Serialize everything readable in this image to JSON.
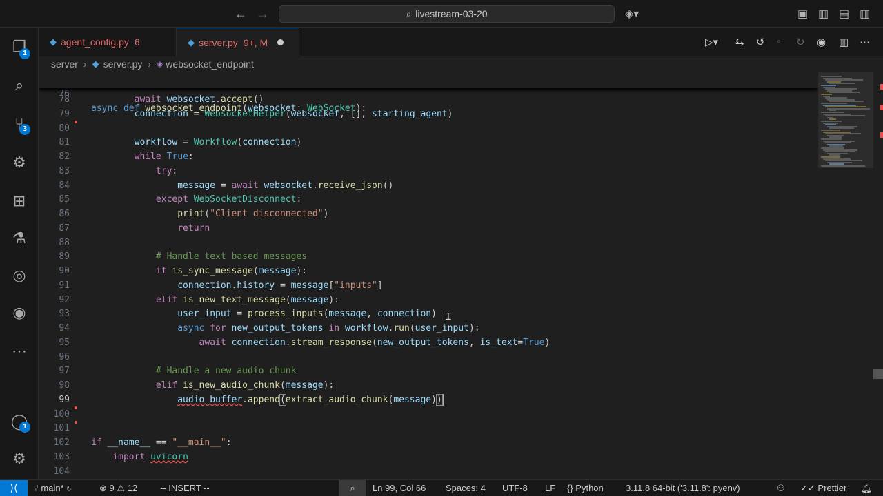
{
  "titlebar": {
    "back_icon": "arrow-left-icon",
    "forward_icon": "arrow-right-icon",
    "search_text": "livestream-03-20",
    "search_icon": "search-icon"
  },
  "activity": {
    "explorer_badge": "1",
    "scm_badge": "3",
    "accounts_badge": "1"
  },
  "tabs": [
    {
      "label": "agent_config.py",
      "badge": "6"
    },
    {
      "label": "server.py",
      "badge": "9+, M"
    }
  ],
  "breadcrumb": {
    "folder": "server",
    "file": "server.py",
    "symbol": "websocket_endpoint"
  },
  "editor": {
    "sticky": {
      "num": "76",
      "html": "<span class=\"kw\">async</span> <span class=\"kw\">def</span> <span class=\"fn\">websocket_endpoint</span>(<span class=\"var\">websocket</span>: <span class=\"cls\">WebSocket</span>):"
    },
    "lines": [
      {
        "num": "78",
        "html": "        <span class=\"kw2\">await</span> <span class=\"var\">websocket</span>.<span class=\"fn\">accept</span>()"
      },
      {
        "num": "79",
        "html": "        <span class=\"var\">connection</span> = <span class=\"cls\">WebsocketHelper</span>(<span class=\"var\">websocket</span>, [], <span class=\"var\">starting_agent</span>)"
      },
      {
        "num": "80",
        "html": ""
      },
      {
        "num": "81",
        "html": "        <span class=\"var\">workflow</span> = <span class=\"cls\">Workflow</span>(<span class=\"var\">connection</span>)"
      },
      {
        "num": "82",
        "html": "        <span class=\"kw2\">while</span> <span class=\"kw\">True</span>:"
      },
      {
        "num": "83",
        "html": "            <span class=\"kw2\">try</span>:"
      },
      {
        "num": "84",
        "html": "                <span class=\"var\">message</span> = <span class=\"kw2\">await</span> <span class=\"var\">websocket</span>.<span class=\"fn\">receive_json</span>()"
      },
      {
        "num": "85",
        "html": "            <span class=\"kw2\">except</span> <span class=\"cls\">WebSocketDisconnect</span>:"
      },
      {
        "num": "86",
        "html": "                <span class=\"fn\">print</span>(<span class=\"str\">\"Client disconnected\"</span>)"
      },
      {
        "num": "87",
        "html": "                <span class=\"kw2\">return</span>"
      },
      {
        "num": "88",
        "html": ""
      },
      {
        "num": "89",
        "html": "            <span class=\"cm\"># Handle text based messages</span>"
      },
      {
        "num": "90",
        "html": "            <span class=\"kw2\">if</span> <span class=\"fn\">is_sync_message</span>(<span class=\"var\">message</span>):"
      },
      {
        "num": "91",
        "html": "                <span class=\"var\">connection</span>.<span class=\"var\">history</span> = <span class=\"var\">message</span>[<span class=\"str\">\"inputs\"</span>]"
      },
      {
        "num": "92",
        "html": "            <span class=\"kw2\">elif</span> <span class=\"fn\">is_new_text_message</span>(<span class=\"var\">message</span>):"
      },
      {
        "num": "93",
        "html": "                <span class=\"var\">user_input</span> = <span class=\"fn\">process_inputs</span>(<span class=\"var\">message</span>, <span class=\"var\">connection</span>)"
      },
      {
        "num": "94",
        "html": "                <span class=\"kw\">async</span> <span class=\"kw2\">for</span> <span class=\"var\">new_output_tokens</span> <span class=\"kw2\">in</span> <span class=\"var\">workflow</span>.<span class=\"fn\">run</span>(<span class=\"var\">user_input</span>):"
      },
      {
        "num": "95",
        "html": "                    <span class=\"kw2\">await</span> <span class=\"var\">connection</span>.<span class=\"fn\">stream_response</span>(<span class=\"var\">new_output_tokens</span>, <span class=\"var\">is_text</span>=<span class=\"kw\">True</span>)"
      },
      {
        "num": "96",
        "html": ""
      },
      {
        "num": "97",
        "html": "            <span class=\"cm\"># Handle a new audio chunk</span>"
      },
      {
        "num": "98",
        "html": "            <span class=\"kw2\">elif</span> <span class=\"fn\">is_new_audio_chunk</span>(<span class=\"var\">message</span>):"
      },
      {
        "num": "99",
        "html": "                <span class=\"var squig\">audio_buffer</span>.<span class=\"fn\">append</span><span class=\"bracket-hl\">(</span><span class=\"fn\">extract_audio_chunk</span>(<span class=\"var\">message</span>)<span class=\"bracket-hl\">)</span><span class=\"caret\"></span>"
      },
      {
        "num": "100",
        "html": ""
      },
      {
        "num": "101",
        "html": ""
      },
      {
        "num": "102",
        "html": "<span class=\"kw2\">if</span> <span class=\"var\">__name__</span> == <span class=\"str\">\"__main__\"</span>:"
      },
      {
        "num": "103",
        "html": "    <span class=\"kw2\">import</span> <span class=\"cls squig\">uvicorn</span>"
      },
      {
        "num": "104",
        "html": ""
      }
    ]
  },
  "statusbar": {
    "branch": "main*",
    "errors": "9",
    "warnings": "12",
    "mode": "-- INSERT --",
    "position": "Ln 99, Col 66",
    "spaces": "Spaces: 4",
    "encoding": "UTF-8",
    "eol": "LF",
    "language": "Python",
    "interpreter": "3.11.8 64-bit ('3.11.8': pyenv)",
    "prettier": "Prettier"
  }
}
